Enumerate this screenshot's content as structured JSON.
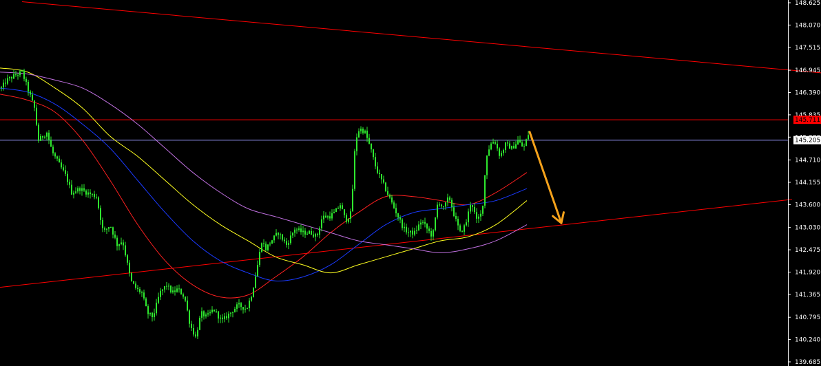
{
  "chart_data": {
    "type": "candlestick",
    "y_axis": {
      "ticks": [
        "148.625",
        "148.070",
        "147.515",
        "146.945",
        "146.390",
        "145.835",
        "145.280",
        "144.710",
        "144.155",
        "143.600",
        "143.030",
        "142.475",
        "141.920",
        "141.365",
        "140.795",
        "140.240",
        "139.685"
      ],
      "ylim": [
        139.685,
        148.625
      ]
    },
    "horizontal_lines": [
      {
        "price": 145.711,
        "label": "145.711",
        "color": "#ff0000"
      },
      {
        "price": 145.205,
        "label": "145.205",
        "color": "#9c9cff"
      }
    ],
    "trendlines": [
      {
        "name": "upper",
        "color": "#ff0000",
        "points": [
          [
            32,
            148.65
          ],
          [
            1192,
            146.88
          ]
        ]
      },
      {
        "name": "lower",
        "color": "#ff0000",
        "points": [
          [
            0,
            141.54
          ],
          [
            1150,
            143.73
          ]
        ]
      }
    ],
    "arrow": {
      "color": "#f5a21b",
      "from": [
        769,
        145.41
      ],
      "to": [
        815,
        143.14
      ]
    },
    "close_anchors": [
      [
        2,
        146.5
      ],
      [
        10,
        146.7
      ],
      [
        20,
        146.8
      ],
      [
        32,
        146.9
      ],
      [
        42,
        146.4
      ],
      [
        50,
        146.0
      ],
      [
        56,
        145.2
      ],
      [
        68,
        145.4
      ],
      [
        76,
        144.9
      ],
      [
        86,
        144.6
      ],
      [
        96,
        144.3
      ],
      [
        104,
        143.9
      ],
      [
        116,
        144.0
      ],
      [
        126,
        143.9
      ],
      [
        140,
        143.8
      ],
      [
        150,
        142.9
      ],
      [
        160,
        143.1
      ],
      [
        170,
        142.6
      ],
      [
        178,
        142.7
      ],
      [
        190,
        141.7
      ],
      [
        198,
        141.5
      ],
      [
        206,
        141.4
      ],
      [
        214,
        140.9
      ],
      [
        222,
        140.8
      ],
      [
        232,
        141.4
      ],
      [
        242,
        141.6
      ],
      [
        250,
        141.4
      ],
      [
        258,
        141.5
      ],
      [
        268,
        141.3
      ],
      [
        276,
        140.6
      ],
      [
        284,
        140.3
      ],
      [
        292,
        140.9
      ],
      [
        300,
        140.8
      ],
      [
        310,
        141.0
      ],
      [
        322,
        140.7
      ],
      [
        334,
        140.9
      ],
      [
        346,
        141.1
      ],
      [
        358,
        141.0
      ],
      [
        366,
        141.4
      ],
      [
        374,
        142.1
      ],
      [
        380,
        142.7
      ],
      [
        386,
        142.5
      ],
      [
        394,
        142.7
      ],
      [
        404,
        142.9
      ],
      [
        416,
        142.6
      ],
      [
        428,
        143.0
      ],
      [
        440,
        142.9
      ],
      [
        452,
        142.9
      ],
      [
        460,
        142.8
      ],
      [
        468,
        143.3
      ],
      [
        478,
        143.3
      ],
      [
        486,
        143.4
      ],
      [
        494,
        143.6
      ],
      [
        502,
        143.2
      ],
      [
        510,
        143.4
      ],
      [
        516,
        145.2
      ],
      [
        522,
        145.5
      ],
      [
        530,
        145.4
      ],
      [
        538,
        145.0
      ],
      [
        546,
        144.5
      ],
      [
        554,
        144.2
      ],
      [
        562,
        143.9
      ],
      [
        570,
        143.6
      ],
      [
        578,
        143.3
      ],
      [
        586,
        143.0
      ],
      [
        594,
        142.9
      ],
      [
        602,
        142.9
      ],
      [
        612,
        143.2
      ],
      [
        620,
        143.0
      ],
      [
        628,
        142.8
      ],
      [
        636,
        143.7
      ],
      [
        644,
        143.5
      ],
      [
        652,
        143.8
      ],
      [
        660,
        143.3
      ],
      [
        668,
        142.9
      ],
      [
        676,
        143.1
      ],
      [
        684,
        143.7
      ],
      [
        692,
        143.2
      ],
      [
        700,
        143.4
      ],
      [
        706,
        144.8
      ],
      [
        712,
        145.1
      ],
      [
        718,
        145.2
      ],
      [
        726,
        144.8
      ],
      [
        734,
        145.1
      ],
      [
        744,
        145.0
      ],
      [
        752,
        145.2
      ],
      [
        760,
        145.0
      ],
      [
        768,
        145.4
      ]
    ],
    "moving_averages": [
      {
        "color": "#ff2020",
        "points": [
          [
            0,
            146.35
          ],
          [
            40,
            146.2
          ],
          [
            80,
            145.9
          ],
          [
            120,
            145.2
          ],
          [
            160,
            144.2
          ],
          [
            200,
            143.1
          ],
          [
            240,
            142.2
          ],
          [
            280,
            141.6
          ],
          [
            320,
            141.3
          ],
          [
            360,
            141.35
          ],
          [
            400,
            141.8
          ],
          [
            440,
            142.3
          ],
          [
            480,
            142.9
          ],
          [
            520,
            143.4
          ],
          [
            560,
            143.8
          ],
          [
            600,
            143.8
          ],
          [
            640,
            143.7
          ],
          [
            680,
            143.6
          ],
          [
            720,
            143.9
          ],
          [
            765,
            144.4
          ]
        ]
      },
      {
        "color": "#1a3aff",
        "points": [
          [
            0,
            146.5
          ],
          [
            40,
            146.4
          ],
          [
            80,
            146.1
          ],
          [
            120,
            145.6
          ],
          [
            160,
            145.0
          ],
          [
            200,
            144.2
          ],
          [
            240,
            143.4
          ],
          [
            280,
            142.7
          ],
          [
            320,
            142.2
          ],
          [
            360,
            141.9
          ],
          [
            400,
            141.7
          ],
          [
            440,
            141.8
          ],
          [
            480,
            142.1
          ],
          [
            520,
            142.6
          ],
          [
            560,
            143.1
          ],
          [
            600,
            143.4
          ],
          [
            640,
            143.5
          ],
          [
            680,
            143.6
          ],
          [
            720,
            143.7
          ],
          [
            765,
            144.0
          ]
        ]
      },
      {
        "color": "#ffff20",
        "points": [
          [
            0,
            147.0
          ],
          [
            40,
            146.9
          ],
          [
            80,
            146.5
          ],
          [
            120,
            146.0
          ],
          [
            160,
            145.3
          ],
          [
            200,
            144.8
          ],
          [
            240,
            144.2
          ],
          [
            280,
            143.6
          ],
          [
            320,
            143.1
          ],
          [
            360,
            142.7
          ],
          [
            400,
            142.3
          ],
          [
            440,
            142.1
          ],
          [
            480,
            141.9
          ],
          [
            520,
            142.1
          ],
          [
            560,
            142.3
          ],
          [
            600,
            142.5
          ],
          [
            640,
            142.7
          ],
          [
            680,
            142.8
          ],
          [
            720,
            143.1
          ],
          [
            765,
            143.7
          ]
        ]
      },
      {
        "color": "#c070e0",
        "points": [
          [
            0,
            146.9
          ],
          [
            40,
            146.85
          ],
          [
            80,
            146.7
          ],
          [
            120,
            146.5
          ],
          [
            160,
            146.1
          ],
          [
            200,
            145.6
          ],
          [
            240,
            145.0
          ],
          [
            280,
            144.4
          ],
          [
            320,
            143.9
          ],
          [
            360,
            143.5
          ],
          [
            400,
            143.3
          ],
          [
            440,
            143.1
          ],
          [
            480,
            142.9
          ],
          [
            520,
            142.7
          ],
          [
            560,
            142.6
          ],
          [
            600,
            142.5
          ],
          [
            640,
            142.4
          ],
          [
            680,
            142.5
          ],
          [
            720,
            142.7
          ],
          [
            765,
            143.1
          ]
        ]
      }
    ]
  },
  "colors": {
    "background": "#000000",
    "candle": "#2ee82e",
    "axis": "#ffffff",
    "tick_text": "#ffffff",
    "tag_red_bg": "#ff0000",
    "tag_red_text": "#000000",
    "tag_white_bg": "#ffffff",
    "tag_white_text": "#000000"
  }
}
